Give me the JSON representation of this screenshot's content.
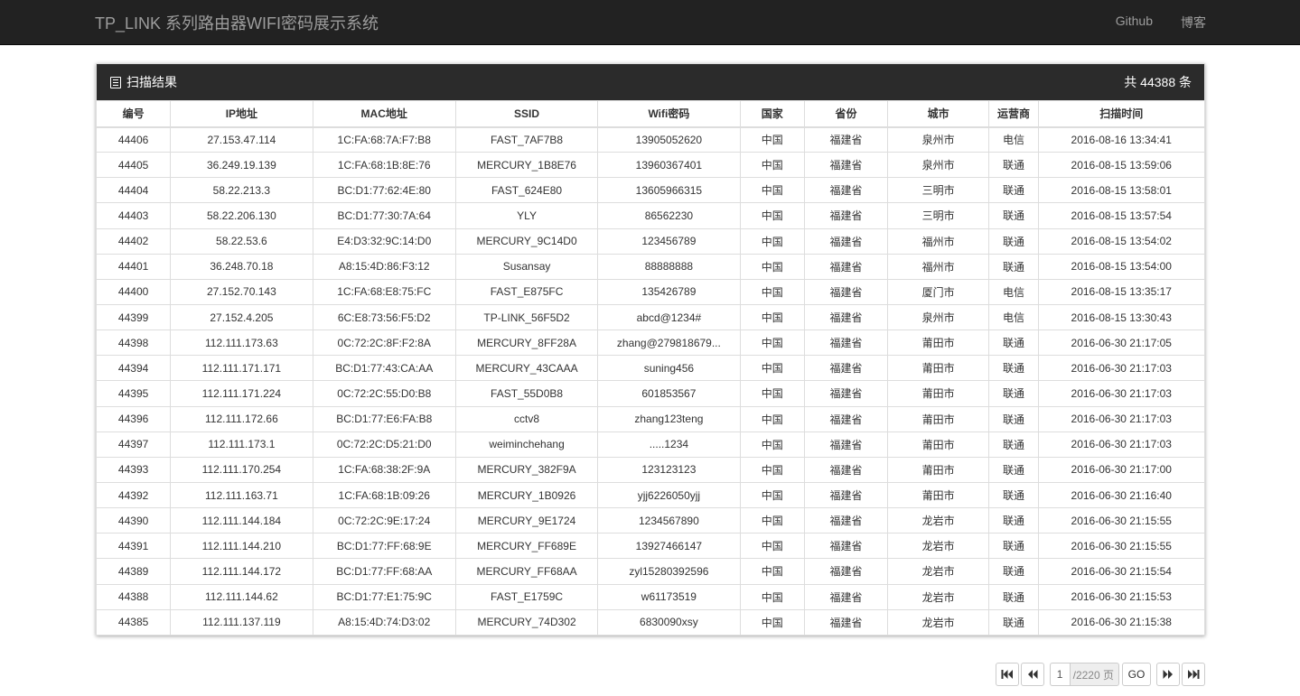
{
  "navbar": {
    "brand": "TP_LINK 系列路由器WIFI密码展示系统",
    "links": [
      "Github",
      "博客"
    ]
  },
  "panel": {
    "title": "扫描结果",
    "total": "共 44388 条"
  },
  "table": {
    "headers": [
      "编号",
      "IP地址",
      "MAC地址",
      "SSID",
      "Wifi密码",
      "国家",
      "省份",
      "城市",
      "运营商",
      "扫描时间"
    ],
    "rows": [
      [
        "44406",
        "27.153.47.114",
        "1C:FA:68:7A:F7:B8",
        "FAST_7AF7B8",
        "13905052620",
        "中国",
        "福建省",
        "泉州市",
        "电信",
        "2016-08-16 13:34:41"
      ],
      [
        "44405",
        "36.249.19.139",
        "1C:FA:68:1B:8E:76",
        "MERCURY_1B8E76",
        "13960367401",
        "中国",
        "福建省",
        "泉州市",
        "联通",
        "2016-08-15 13:59:06"
      ],
      [
        "44404",
        "58.22.213.3",
        "BC:D1:77:62:4E:80",
        "FAST_624E80",
        "13605966315",
        "中国",
        "福建省",
        "三明市",
        "联通",
        "2016-08-15 13:58:01"
      ],
      [
        "44403",
        "58.22.206.130",
        "BC:D1:77:30:7A:64",
        "YLY",
        "86562230",
        "中国",
        "福建省",
        "三明市",
        "联通",
        "2016-08-15 13:57:54"
      ],
      [
        "44402",
        "58.22.53.6",
        "E4:D3:32:9C:14:D0",
        "MERCURY_9C14D0",
        "123456789",
        "中国",
        "福建省",
        "福州市",
        "联通",
        "2016-08-15 13:54:02"
      ],
      [
        "44401",
        "36.248.70.18",
        "A8:15:4D:86:F3:12",
        "Susansay",
        "88888888",
        "中国",
        "福建省",
        "福州市",
        "联通",
        "2016-08-15 13:54:00"
      ],
      [
        "44400",
        "27.152.70.143",
        "1C:FA:68:E8:75:FC",
        "FAST_E875FC",
        "135426789",
        "中国",
        "福建省",
        "厦门市",
        "电信",
        "2016-08-15 13:35:17"
      ],
      [
        "44399",
        "27.152.4.205",
        "6C:E8:73:56:F5:D2",
        "TP-LINK_56F5D2",
        "abcd@1234#",
        "中国",
        "福建省",
        "泉州市",
        "电信",
        "2016-08-15 13:30:43"
      ],
      [
        "44398",
        "112.111.173.63",
        "0C:72:2C:8F:F2:8A",
        "MERCURY_8FF28A",
        "zhang@279818679...",
        "中国",
        "福建省",
        "莆田市",
        "联通",
        "2016-06-30 21:17:05"
      ],
      [
        "44394",
        "112.111.171.171",
        "BC:D1:77:43:CA:AA",
        "MERCURY_43CAAA",
        "suning456",
        "中国",
        "福建省",
        "莆田市",
        "联通",
        "2016-06-30 21:17:03"
      ],
      [
        "44395",
        "112.111.171.224",
        "0C:72:2C:55:D0:B8",
        "FAST_55D0B8",
        "601853567",
        "中国",
        "福建省",
        "莆田市",
        "联通",
        "2016-06-30 21:17:03"
      ],
      [
        "44396",
        "112.111.172.66",
        "BC:D1:77:E6:FA:B8",
        "cctv8",
        "zhang123teng",
        "中国",
        "福建省",
        "莆田市",
        "联通",
        "2016-06-30 21:17:03"
      ],
      [
        "44397",
        "112.111.173.1",
        "0C:72:2C:D5:21:D0",
        "weiminchehang",
        ".....1234",
        "中国",
        "福建省",
        "莆田市",
        "联通",
        "2016-06-30 21:17:03"
      ],
      [
        "44393",
        "112.111.170.254",
        "1C:FA:68:38:2F:9A",
        "MERCURY_382F9A",
        "123123123",
        "中国",
        "福建省",
        "莆田市",
        "联通",
        "2016-06-30 21:17:00"
      ],
      [
        "44392",
        "112.111.163.71",
        "1C:FA:68:1B:09:26",
        "MERCURY_1B0926",
        "yjj6226050yjj",
        "中国",
        "福建省",
        "莆田市",
        "联通",
        "2016-06-30 21:16:40"
      ],
      [
        "44390",
        "112.111.144.184",
        "0C:72:2C:9E:17:24",
        "MERCURY_9E1724",
        "1234567890",
        "中国",
        "福建省",
        "龙岩市",
        "联通",
        "2016-06-30 21:15:55"
      ],
      [
        "44391",
        "112.111.144.210",
        "BC:D1:77:FF:68:9E",
        "MERCURY_FF689E",
        "13927466147",
        "中国",
        "福建省",
        "龙岩市",
        "联通",
        "2016-06-30 21:15:55"
      ],
      [
        "44389",
        "112.111.144.172",
        "BC:D1:77:FF:68:AA",
        "MERCURY_FF68AA",
        "zyl15280392596",
        "中国",
        "福建省",
        "龙岩市",
        "联通",
        "2016-06-30 21:15:54"
      ],
      [
        "44388",
        "112.111.144.62",
        "BC:D1:77:E1:75:9C",
        "FAST_E1759C",
        "w61173519",
        "中国",
        "福建省",
        "龙岩市",
        "联通",
        "2016-06-30 21:15:53"
      ],
      [
        "44385",
        "112.111.137.119",
        "A8:15:4D:74:D3:02",
        "MERCURY_74D302",
        "6830090xsy",
        "中国",
        "福建省",
        "龙岩市",
        "联通",
        "2016-06-30 21:15:38"
      ]
    ]
  },
  "pager": {
    "current_page": "1",
    "total_pages": "/2220 页",
    "go_label": "GO",
    "icons": [
      "first-page-icon",
      "prev-page-icon",
      "next-page-icon",
      "last-page-icon"
    ]
  }
}
